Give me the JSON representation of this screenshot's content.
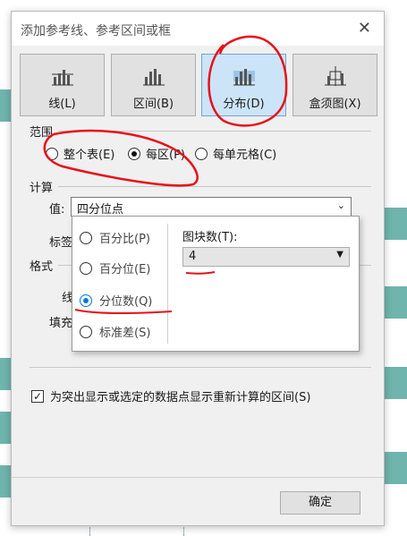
{
  "window": {
    "title": "添加参考线、参考区间或框"
  },
  "tabs": [
    {
      "label": "线(L)",
      "icon": "line-chart-icon"
    },
    {
      "label": "区间(B)",
      "icon": "band-chart-icon"
    },
    {
      "label": "分布(D)",
      "icon": "distribution-chart-icon",
      "active": true
    },
    {
      "label": "盒须图(X)",
      "icon": "box-plot-icon"
    }
  ],
  "scope": {
    "label": "范围",
    "options": [
      {
        "label": "整个表(E)",
        "selected": false
      },
      {
        "label": "每区(P)",
        "selected": true
      },
      {
        "label": "每单元格(C)",
        "selected": false
      }
    ]
  },
  "calc": {
    "label": "计算",
    "value_label": "值:",
    "value": "四分位点",
    "tag_label": "标签"
  },
  "format": {
    "label": "格式",
    "line_label": "线",
    "fill_label": "填充"
  },
  "popup": {
    "options": [
      {
        "label": "百分比(P)",
        "selected": false
      },
      {
        "label": "百分位(E)",
        "selected": false
      },
      {
        "label": "分位数(Q)",
        "selected": true
      },
      {
        "label": "标准差(S)",
        "selected": false
      }
    ],
    "bins_label": "图块数(T):",
    "bins_value": "4"
  },
  "recalc": {
    "label": "为突出显示或选定的数据点显示重新计算的区间(S)",
    "checked": true
  },
  "ok_label": "确定",
  "colors": {
    "accent": "#0078d7",
    "tab_active": "#cce4f7",
    "annotation": "#e8101a"
  }
}
